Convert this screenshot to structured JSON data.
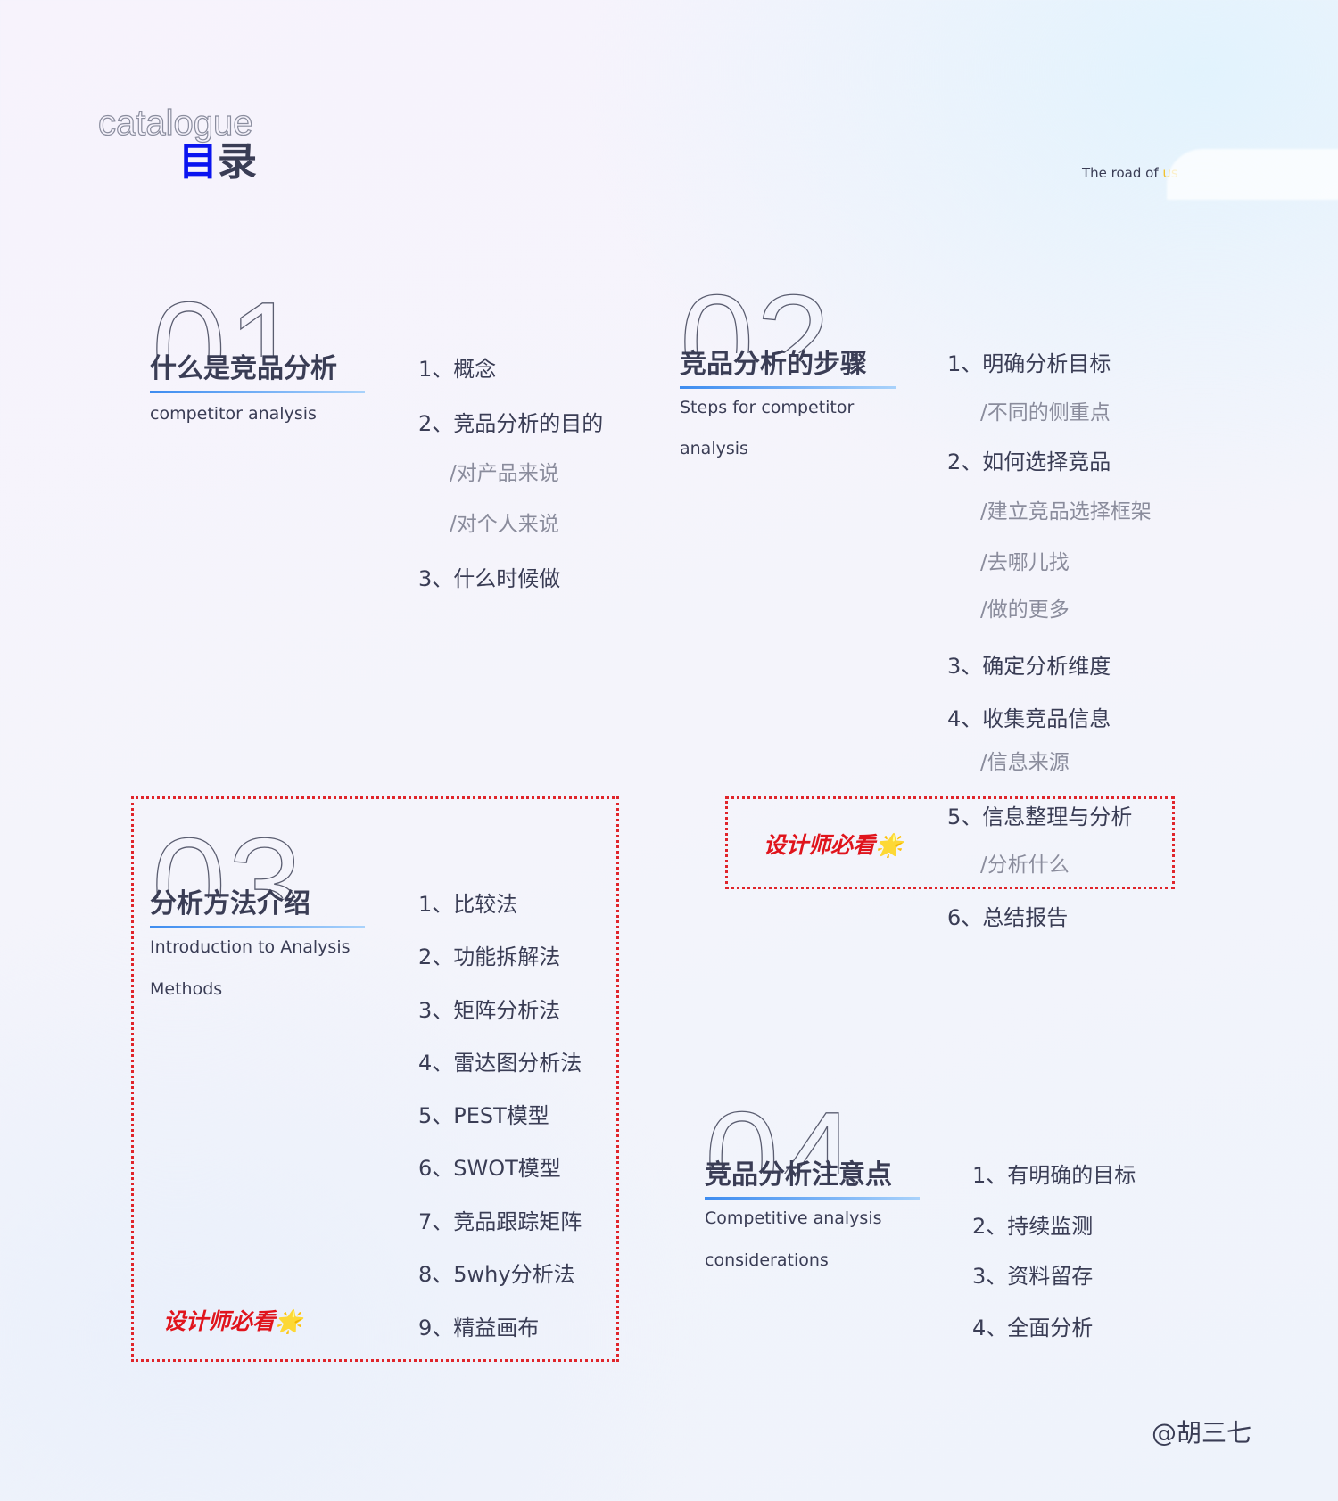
{
  "header": {
    "catalogue": "catalogue",
    "title_accent": "目",
    "title_rest": "录",
    "road_prefix": "The road of ",
    "road_highlight": "us"
  },
  "sections": [
    {
      "number": "01",
      "title": "什么是竞品分析",
      "subtitle": [
        "competitor analysis"
      ],
      "items": [
        {
          "text": "1、概念",
          "level": 1
        },
        {
          "text": "2、竞品分析的目的",
          "level": 1
        },
        {
          "text": "/对产品来说",
          "level": 2
        },
        {
          "text": "/对个人来说",
          "level": 2
        },
        {
          "text": "3、什么时候做",
          "level": 1
        }
      ]
    },
    {
      "number": "02",
      "title": "竞品分析的步骤",
      "subtitle": [
        "Steps for competitor",
        "analysis"
      ],
      "items": [
        {
          "text": "1、明确分析目标",
          "level": 1
        },
        {
          "text": "/不同的侧重点",
          "level": 2
        },
        {
          "text": "2、如何选择竞品",
          "level": 1
        },
        {
          "text": "/建立竞品选择框架",
          "level": 2
        },
        {
          "text": "/去哪儿找",
          "level": 2
        },
        {
          "text": "/做的更多",
          "level": 2
        },
        {
          "text": "3、确定分析维度",
          "level": 1
        },
        {
          "text": "4、收集竞品信息",
          "level": 1
        },
        {
          "text": "/信息来源",
          "level": 2
        },
        {
          "text": "5、信息整理与分析",
          "level": 1
        },
        {
          "text": "/分析什么",
          "level": 2
        },
        {
          "text": "6、总结报告",
          "level": 1
        }
      ]
    },
    {
      "number": "03",
      "title": "分析方法介绍",
      "subtitle": [
        "Introduction to Analysis",
        "Methods"
      ],
      "items": [
        {
          "text": "1、比较法",
          "level": 1
        },
        {
          "text": "2、功能拆解法",
          "level": 1
        },
        {
          "text": "3、矩阵分析法",
          "level": 1
        },
        {
          "text": "4、雷达图分析法",
          "level": 1
        },
        {
          "text": "5、PEST模型",
          "level": 1
        },
        {
          "text": "6、SWOT模型",
          "level": 1
        },
        {
          "text": "7、竞品跟踪矩阵",
          "level": 1
        },
        {
          "text": "8、5why分析法",
          "level": 1
        },
        {
          "text": "9、精益画布",
          "level": 1
        }
      ]
    },
    {
      "number": "04",
      "title": "竞品分析注意点",
      "subtitle": [
        "Competitive analysis",
        "considerations"
      ],
      "items": [
        {
          "text": "1、有明确的目标",
          "level": 1
        },
        {
          "text": "2、持续监测",
          "level": 1
        },
        {
          "text": "3、资料留存",
          "level": 1
        },
        {
          "text": "4、全面分析",
          "level": 1
        }
      ]
    }
  ],
  "highlight": {
    "label": "设计师必看",
    "icon": "star-emoji",
    "color": "#e0141c"
  },
  "signature": "@胡三七",
  "colors": {
    "accent": "#0a14f0",
    "text": "#3a3d55",
    "highlight_box": "#e0252b"
  }
}
